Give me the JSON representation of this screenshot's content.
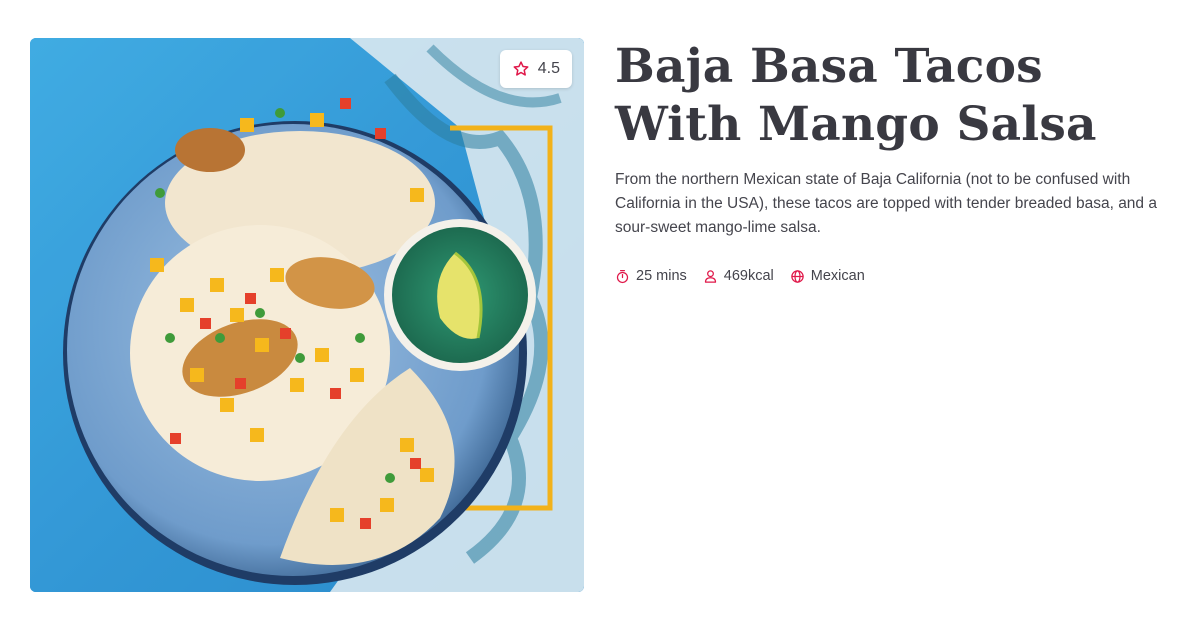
{
  "recipe": {
    "title": "Baja Basa Tacos With Mango Salsa",
    "description": "From the northern Mexican state of Baja California (not to be confused with California in the USA), these tacos are topped with tender breaded basa, and a sour-sweet mango-lime salsa.",
    "rating": "4.5",
    "meta": {
      "time": "25 mins",
      "calories": "469kcal",
      "cuisine": "Mexican"
    }
  },
  "icons": {
    "rating": "star-outline-icon",
    "time": "stopwatch-icon",
    "calories": "person-icon",
    "cuisine": "globe-icon"
  },
  "colors": {
    "accent": "#e0194a",
    "title": "#393941",
    "text": "#45454d",
    "background_blue": "#2a8fd1"
  }
}
